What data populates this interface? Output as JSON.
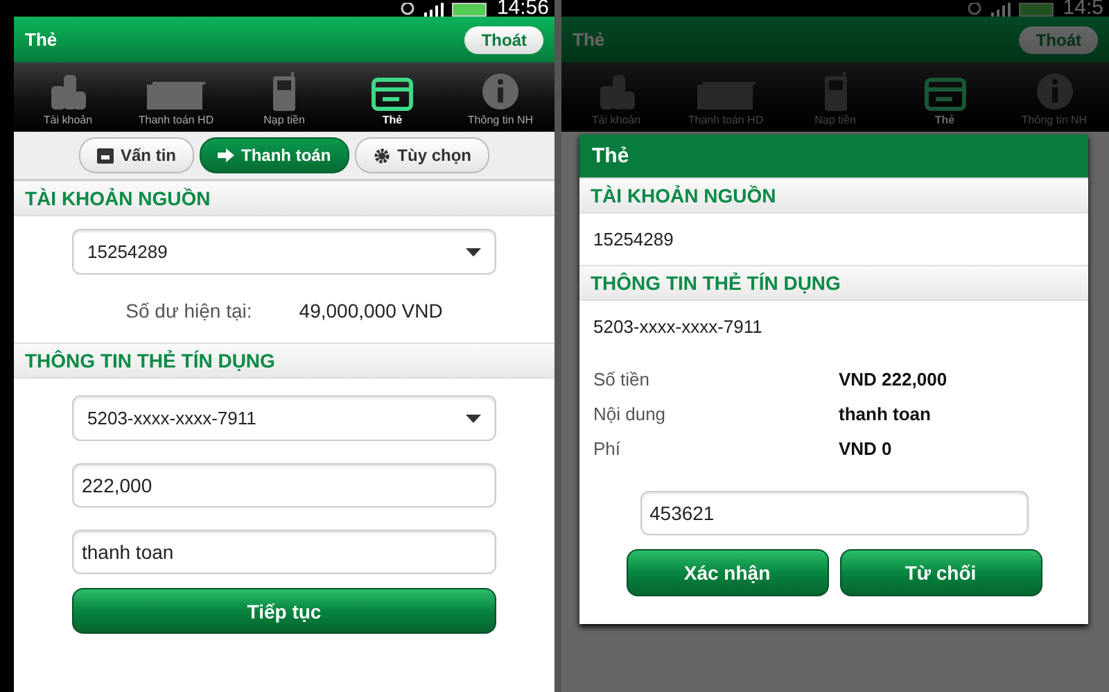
{
  "screens": [
    {
      "dimmed": false,
      "status_bar": {
        "time": "14:56"
      },
      "app_bar": {
        "title": "Thẻ",
        "exit_button": "Thoát"
      },
      "nav_tabs": [
        {
          "label": "Tài khoản",
          "selected": false
        },
        {
          "label": "Thanh toán HD",
          "selected": false
        },
        {
          "label": "Nạp tiền",
          "selected": false
        },
        {
          "label": "Thẻ",
          "selected": true
        },
        {
          "label": "Thông tin NH",
          "selected": false
        }
      ],
      "segments": [
        {
          "label": "Vấn tin",
          "selected": false
        },
        {
          "label": "Thanh toán",
          "selected": true
        },
        {
          "label": "Tùy chọn",
          "selected": false
        }
      ],
      "source_account": {
        "heading": "TÀI KHOẢN NGUỒN",
        "account": "15254289",
        "balance_label": "Số dư hiện tại:",
        "balance": "49,000,000 VND"
      },
      "card_info": {
        "heading": "THÔNG TIN THẺ TÍN DỤNG",
        "card": "5203-xxxx-xxxx-7911",
        "amount": "222,000",
        "note": "thanh toan"
      },
      "continue_button": "Tiếp tục"
    },
    {
      "dimmed": true,
      "status_bar": {
        "time": "14:5"
      },
      "app_bar": {
        "title": "Thẻ",
        "exit_button": "Thoát"
      },
      "nav_tabs": [
        {
          "label": "Tài khoản",
          "selected": false
        },
        {
          "label": "Thanh toán HD",
          "selected": false
        },
        {
          "label": "Nạp tiền",
          "selected": false
        },
        {
          "label": "Thẻ",
          "selected": true
        },
        {
          "label": "Thông tin NH",
          "selected": false
        }
      ],
      "dialog": {
        "title": "Thẻ",
        "source_heading": "TÀI KHOẢN NGUỒN",
        "account": "15254289",
        "card_heading": "THÔNG TIN THẺ TÍN DỤNG",
        "card": "5203-xxxx-xxxx-7911",
        "details": [
          {
            "label": "Số tiền",
            "value": "VND 222,000"
          },
          {
            "label": "Nội dung",
            "value": "thanh toan"
          },
          {
            "label": "Phí",
            "value": "VND 0"
          }
        ],
        "otp": "453621",
        "buttons": [
          "Xác nhận",
          "Từ chối"
        ]
      }
    }
  ]
}
